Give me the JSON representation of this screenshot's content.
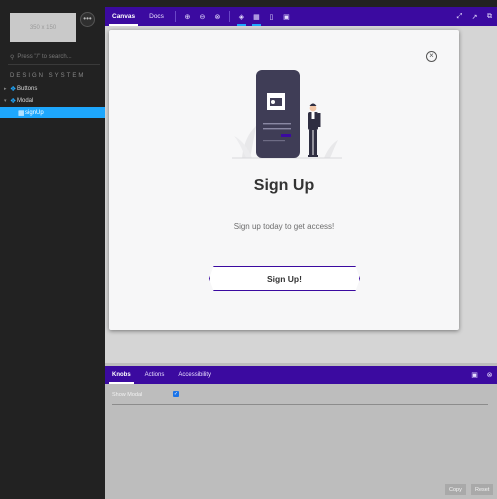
{
  "sidebar": {
    "logo_text": "350 x 150",
    "menu_icon": "ellipsis-icon",
    "search_placeholder": "Press \"/\" to search...",
    "section_title": "DESIGN SYSTEM",
    "items": [
      {
        "label": "Buttons",
        "icon": "component-icon",
        "expanded": false
      },
      {
        "label": "Modal",
        "icon": "component-icon",
        "expanded": true
      },
      {
        "label": "signUp",
        "icon": "story-icon",
        "selected": true
      }
    ]
  },
  "toolbar": {
    "tabs": [
      {
        "label": "Canvas",
        "active": true
      },
      {
        "label": "Docs",
        "active": false
      }
    ],
    "icons": [
      "zoom-in-icon",
      "zoom-out-icon",
      "zoom-reset-icon",
      "background-icon",
      "grid-icon",
      "measure-icon",
      "outline-icon"
    ],
    "right_icons": [
      "fullscreen-icon",
      "new-tab-icon",
      "copy-link-icon"
    ]
  },
  "modal": {
    "close_icon": "close-circle-icon",
    "title": "Sign Up",
    "subtitle": "Sign up today to get access!",
    "button_label": "Sign Up!"
  },
  "addons": {
    "tabs": [
      {
        "label": "Knobs",
        "active": true
      },
      {
        "label": "Actions",
        "active": false
      },
      {
        "label": "Accessibility",
        "active": false
      }
    ],
    "knob_label": "Show Modal",
    "knob_checked": true,
    "copy_label": "Copy",
    "reset_label": "Reset"
  },
  "colors": {
    "accent": "#3b0aa0",
    "selection": "#1ea7fd",
    "sidebar_bg": "#222222"
  }
}
